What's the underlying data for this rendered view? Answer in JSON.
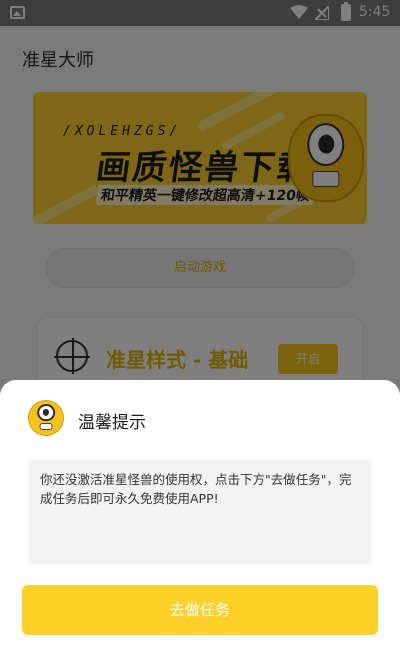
{
  "status_bar": {
    "time": "5:45",
    "icons": [
      "gallery-icon",
      "wifi-icon",
      "sim-icon",
      "battery-charging-icon"
    ]
  },
  "app": {
    "title": "准星大师",
    "banner": {
      "code": "/XOLEHZGS/",
      "headline": "画质怪兽下载",
      "subline": "和平精英一键修改超高清+120帧",
      "accent_color": "#fccf2c"
    },
    "launch_button": "启动游戏",
    "style_card": {
      "label": "准星样式 - 基础",
      "button": "开启"
    }
  },
  "dialog": {
    "title": "温馨提示",
    "message": "你还没激活准星怪兽的使用权，点击下方\"去做任务\"，完成任务后即可永久免费使用APP!",
    "action_button": "去做任务",
    "button_color": "#fdd12a"
  }
}
